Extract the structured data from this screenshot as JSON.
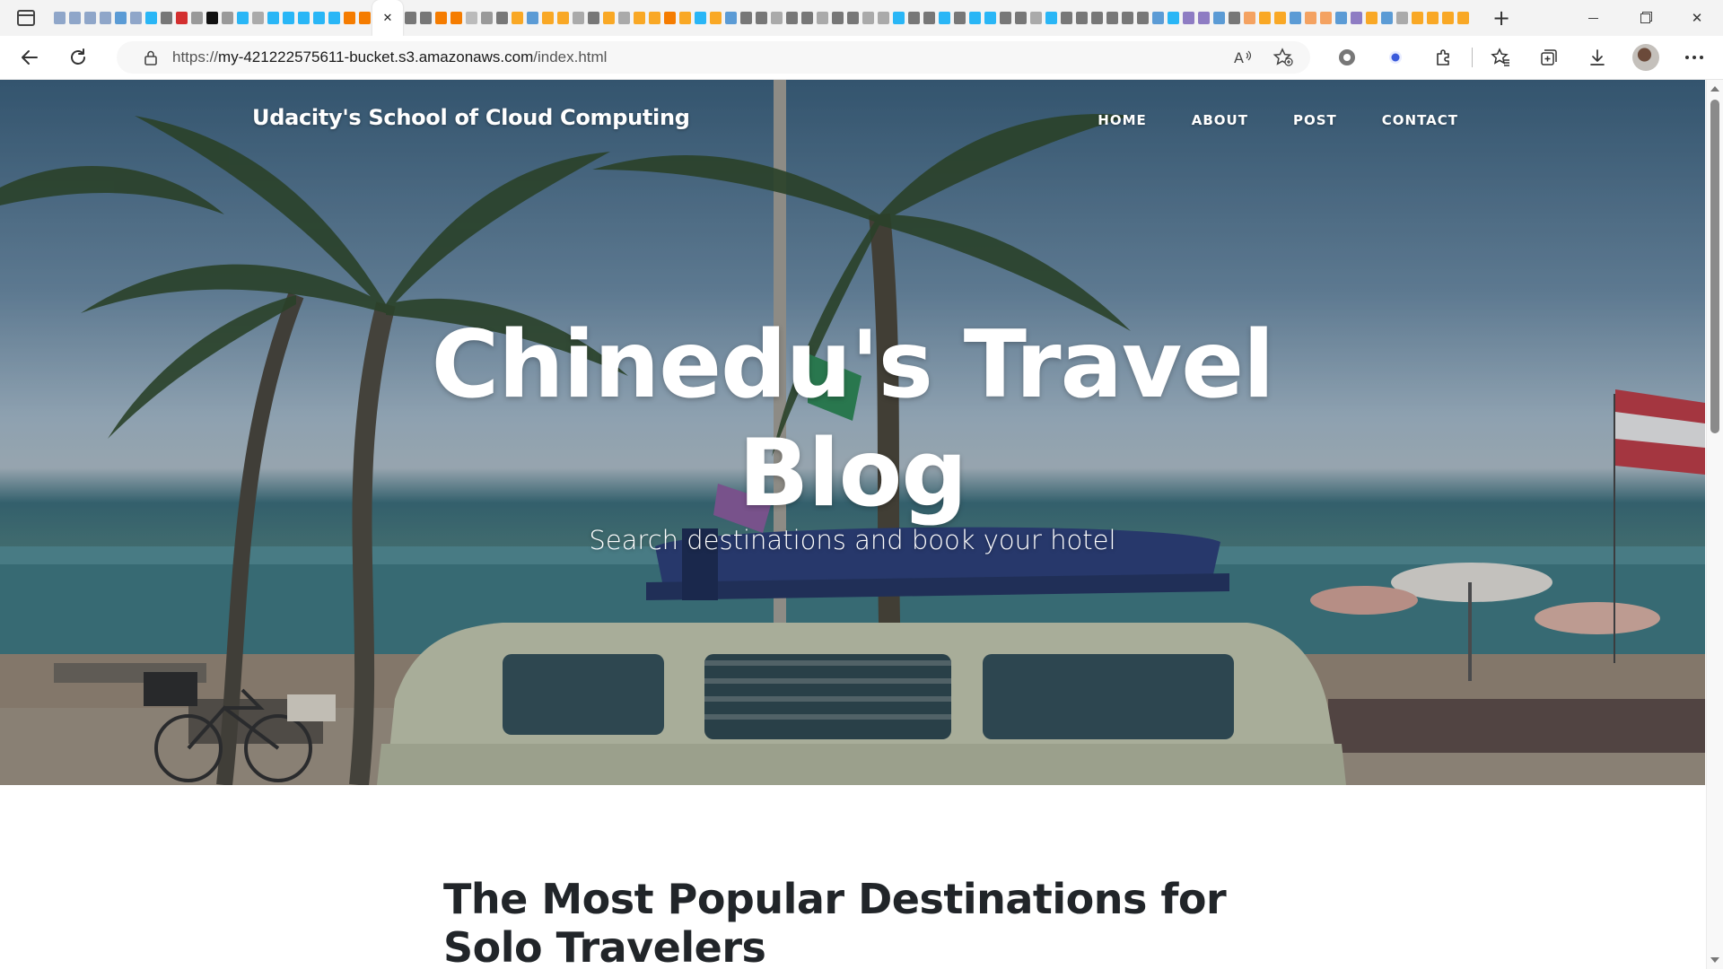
{
  "browser": {
    "address": {
      "scheme": "https://",
      "host": "my-421222575611-bucket.s3.amazonaws.com",
      "path": "/index.html"
    },
    "tab_favicon_colors": [
      "#8fa6c9",
      "#8fa6c9",
      "#8fa6c9",
      "#8fa6c9",
      "#5b9bd5",
      "#8fa6c9",
      "#29b6f6",
      "#777",
      "#d32f2f",
      "#999",
      "#111",
      "#999",
      "#29b6f6",
      "#aaa",
      "#29b6f6",
      "#29b6f6",
      "#29b6f6",
      "#29b6f6",
      "#29b6f6",
      "#f57c00",
      "#f57c00"
    ],
    "tab_favicon_colors_right": [
      "#777",
      "#777",
      "#f57c00",
      "#f57c00",
      "#bbb",
      "#999",
      "#777",
      "#f9a825",
      "#5b9bd5",
      "#f9a825",
      "#f9a825",
      "#aaa",
      "#777",
      "#f9a825",
      "#aaa",
      "#f9a825",
      "#f9a825",
      "#f57c00",
      "#f9a825",
      "#29b6f6",
      "#f9a825",
      "#5b9bd5",
      "#777",
      "#777",
      "#aaa",
      "#777",
      "#777",
      "#aaa",
      "#777",
      "#777",
      "#aaa",
      "#aaa",
      "#29b6f6",
      "#777",
      "#777",
      "#29b6f6",
      "#777",
      "#29b6f6",
      "#29b6f6",
      "#777",
      "#777",
      "#aaa",
      "#29b6f6",
      "#777",
      "#777",
      "#777",
      "#777",
      "#777",
      "#777",
      "#5b9bd5",
      "#29b6f6",
      "#8e7cc3",
      "#8e7cc3",
      "#5b9bd5",
      "#777",
      "#f4a261",
      "#f9a825",
      "#f9a825",
      "#5b9bd5",
      "#f4a261",
      "#f4a261",
      "#5b9bd5",
      "#8e7cc3",
      "#f9a825",
      "#5b9bd5",
      "#aaa",
      "#f9a825",
      "#f9a825",
      "#f9a825",
      "#f9a825"
    ]
  },
  "site": {
    "brand": "Udacity's School of Cloud Computing",
    "nav": [
      "HOME",
      "ABOUT",
      "POST",
      "CONTACT"
    ],
    "hero_title_line1": "Chinedu's Travel",
    "hero_title_line2": "Blog",
    "hero_subtitle": "Search destinations and book your hotel",
    "post_heading": "The Most Popular Destinations for Solo Travelers"
  }
}
